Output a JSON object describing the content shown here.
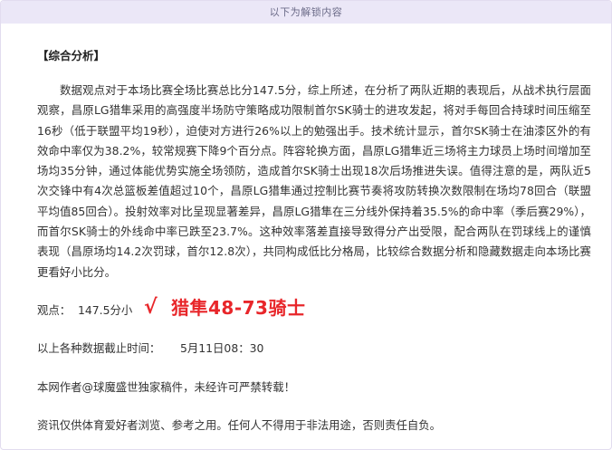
{
  "banner": {
    "text": "以下为解锁内容"
  },
  "section": {
    "title": "【综合分析】"
  },
  "analysis": {
    "paragraph": "数据观点对于本场比赛全场比赛总比分147.5分，综上所述，在分析了两队近期的表现后，从战术执行层面观察，昌原LG猎隼采用的高强度半场防守策略成功限制首尔SK骑士的进攻发起，将对手每回合持球时间压缩至16秒（低于联盟平均19秒），迫使对方进行26%以上的勉强出手。技术统计显示，首尔SK骑士在油漆区外的有效命中率仅为38.2%，较常规赛下降9个百分点。阵容轮换方面，昌原LG猎隼近三场将主力球员上场时间增加至场均35分钟，通过体能优势实施全场领防，造成首尔SK骑士出现18次后场推进失误。值得注意的是，两队近5次交锋中有4次总篮板差值超过10个，昌原LG猎隼通过控制比赛节奏将攻防转换次数限制在场均78回合（联盟平均值85回合）。投射效率对比呈现显著差异，昌原LG猎隼在三分线外保持着35.5%的命中率（季后赛29%），而首尔SK骑士的外线命中率已跌至23.7%。这种效率落差直接导致得分产出受限，配合两队在罚球线上的谨慎表现（昌原场均14.2次罚球，首尔12.8次），共同构成低比分格局，比较综合数据分析和隐藏数据走向本场比赛更看好小比分。"
  },
  "pick": {
    "label": "观点：",
    "value": "147.5分小",
    "check": "√",
    "result": "猎隼48-73骑士",
    "result_color": "#e8262a"
  },
  "cutoff": {
    "label": "以上各种数据截止时间：",
    "value": "5月11日08：30"
  },
  "copyright": {
    "text": "本网作者@球魔盛世独家稿件，未经许可严禁转载！"
  },
  "disclaimer": {
    "text": "资讯仅供体育爱好者浏览、参考之用。任何人不得用于非法用途，否则责任自负。"
  },
  "colors": {
    "banner_bg": "#ebe7f7",
    "banner_text": "#6b6b88",
    "body_text": "#333333",
    "accent_red": "#e8262a"
  }
}
